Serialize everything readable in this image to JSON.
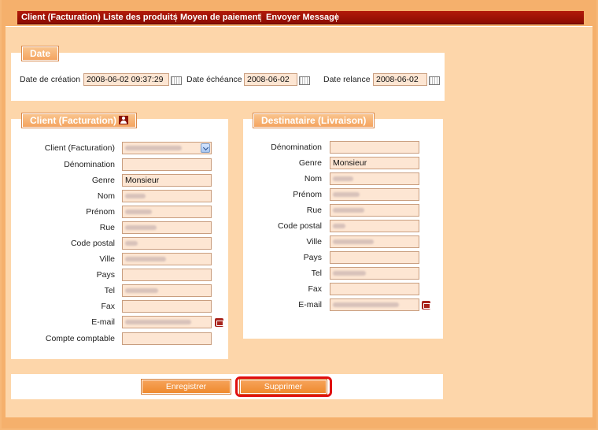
{
  "nav": {
    "tabs": [
      "Client (Facturation)",
      "Liste des produits",
      "Moyen de paiement",
      "Envoyer Message"
    ]
  },
  "date_section": {
    "title": "Date",
    "creation_label": "Date de création",
    "creation_value": "2008-06-02 09:37:29",
    "echeance_label": "Date échéance",
    "echeance_value": "2008-06-02",
    "relance_label": "Date relance",
    "relance_value": "2008-06-02"
  },
  "client": {
    "title": "Client (Facturation)",
    "labels": {
      "client": "Client (Facturation)",
      "denomination": "Dénomination",
      "genre": "Genre",
      "nom": "Nom",
      "prenom": "Prénom",
      "rue": "Rue",
      "code_postal": "Code postal",
      "ville": "Ville",
      "pays": "Pays",
      "tel": "Tel",
      "fax": "Fax",
      "email": "E-mail",
      "compte": "Compte comptable"
    },
    "genre_value": "Monsieur"
  },
  "destinataire": {
    "title": "Destinataire (Livraison)",
    "labels": {
      "denomination": "Dénomination",
      "genre": "Genre",
      "nom": "Nom",
      "prenom": "Prénom",
      "rue": "Rue",
      "code_postal": "Code postal",
      "ville": "Ville",
      "pays": "Pays",
      "tel": "Tel",
      "fax": "Fax",
      "email": "E-mail"
    },
    "genre_value": "Monsieur"
  },
  "actions": {
    "save_label": "Enregistrer",
    "delete_label": "Supprimer"
  },
  "colors": {
    "accent": "#f4a460",
    "nav_bg": "#9a1205",
    "highlight": "#e01010"
  }
}
